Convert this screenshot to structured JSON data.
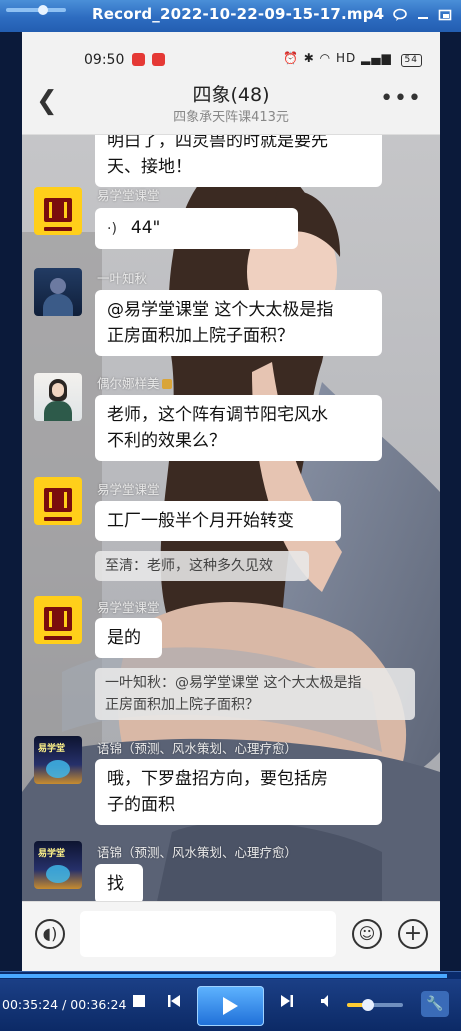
{
  "player": {
    "file_title": "Record_2022-10-22-09-15-17.mp4",
    "position_fraction": 0.97,
    "time_display": "00:35:24 / 00:36:24",
    "volume_fraction": 0.38
  },
  "status_bar": {
    "time": "09:50",
    "battery": "54"
  },
  "header": {
    "title": "四象(48)",
    "subtitle": "四象承天阵课413元"
  },
  "messages": [
    {
      "type": "text",
      "text_lines": [
        "明白了，四灵兽的时就是要先",
        "天、接地！"
      ]
    },
    {
      "sender": "易学堂课堂",
      "type": "voice",
      "duration": "44\""
    },
    {
      "sender": "一叶知秋",
      "type": "text",
      "text_lines": [
        "@易学堂课堂  这个大太极是指",
        "正房面积加上院子面积？"
      ]
    },
    {
      "sender": "偶尔娜样美",
      "type": "text",
      "text_lines": [
        "老师，这个阵有调节阳宅风水",
        "不利的效果么？"
      ]
    },
    {
      "sender": "易学堂课堂",
      "type": "text",
      "text_lines": [
        "工厂一般半个月开始转变"
      ],
      "quote": "至清：老师，这种多久见效"
    },
    {
      "sender": "易学堂课堂",
      "type": "text",
      "text_lines": [
        "是的"
      ],
      "quote_lines": [
        "一叶知秋：@易学堂课堂 这个大太极是指",
        "正房面积加上院子面积？"
      ]
    },
    {
      "sender": "语锦（预测、风水策划、心理疗愈）",
      "type": "text",
      "text_lines": [
        "哦，下罗盘招方向，要包括房",
        "子的面积"
      ]
    },
    {
      "sender": "语锦（预测、风水策划、心理疗愈）",
      "type": "text",
      "text_lines": [
        "找"
      ]
    }
  ],
  "avatars": {
    "yi_text": "易学堂",
    "stage_text": "易学堂"
  },
  "colors": {
    "player_blue": "#235eb1",
    "bubble": "#ffffff",
    "avatar_yellow": "#ffcf1a"
  }
}
